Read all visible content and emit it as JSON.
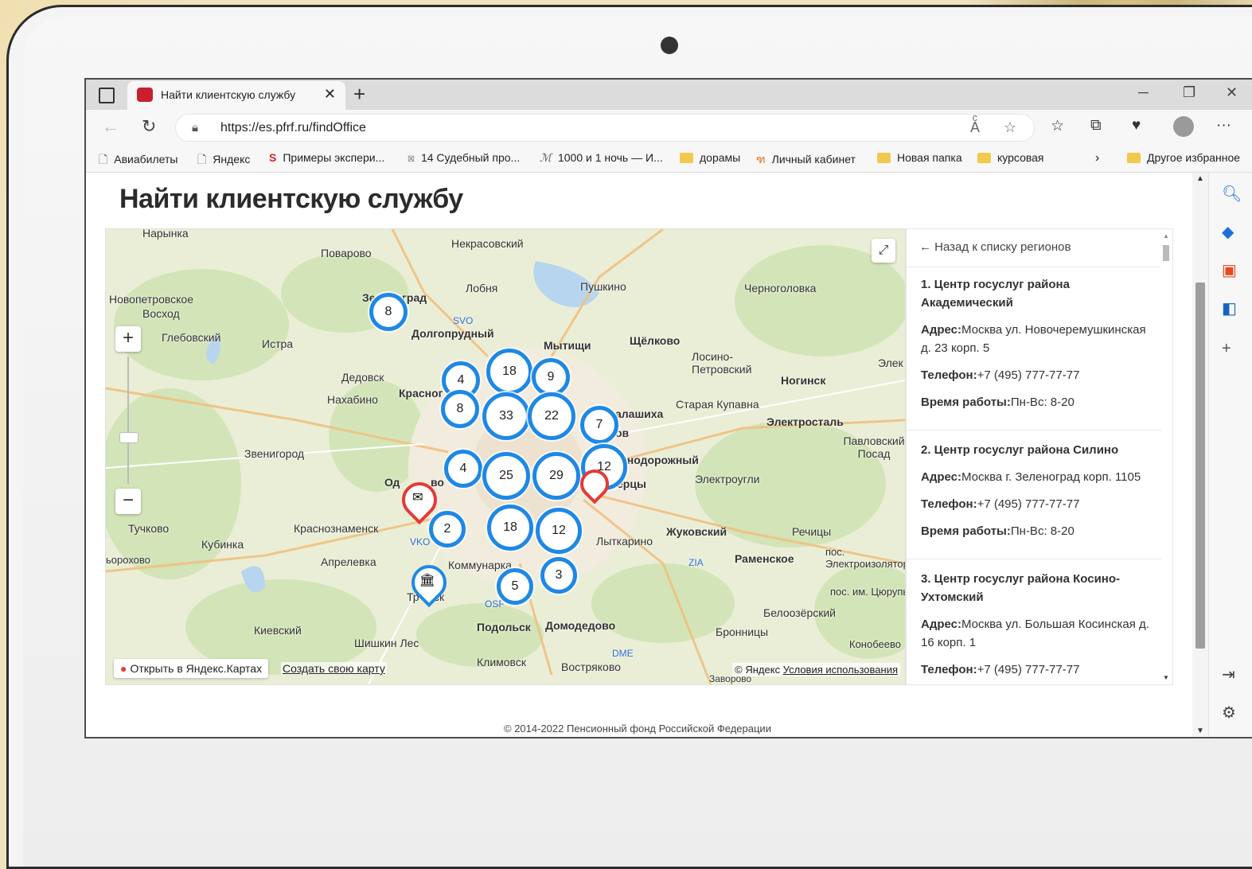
{
  "browser": {
    "tab_title": "Найти клиентскую службу",
    "url": "https://es.pfrf.ru/findOffice",
    "bookmarks": [
      "Авиабилеты",
      "Яндекс",
      "Примеры экспери...",
      "14 Судебный про...",
      "1000 и 1 ночь — И...",
      "дорамы",
      "Личный кабинет",
      "Новая папка",
      "курсовая"
    ],
    "other_favorites": "Другое избранное"
  },
  "page": {
    "title": "Найти клиентскую службу",
    "footer": "© 2014-2022 Пенсионный фонд Российской Федерации"
  },
  "map": {
    "clusters": [
      "8",
      "4",
      "18",
      "9",
      "8",
      "33",
      "22",
      "7",
      "4",
      "25",
      "29",
      "12",
      "2",
      "18",
      "12",
      "3",
      "5"
    ],
    "places": [
      "Нарынка",
      "Некрасовский",
      "Поварово",
      "Новопетровское",
      "Восход",
      "Лобня",
      "Пушкино",
      "Черноголовка",
      "Зеленоград",
      "SVO",
      "Долгопрудный",
      "Мытищи",
      "Щёлково",
      "Глебовский",
      "Истра",
      "Лосино-Петровский",
      "Элек",
      "Дедовск",
      "Ногинск",
      "Нахабино",
      "Красног",
      "Старая Купавна",
      "алашиха",
      "Электросталь",
      "Павловский Посад",
      "Звенигород",
      "ов",
      "езнодорожный",
      "Электроугли",
      "Од",
      "во",
      "ерцы",
      "Тучково",
      "Краснознаменск",
      "Кубинка",
      "VKO",
      "Жуковский",
      "Речицы",
      "Лыткарино",
      "Апрелевка",
      "Коммунарка",
      "ZIA",
      "Раменское",
      "пос. Электроизолятор",
      "Тр",
      "ск",
      "OSF",
      "пос. им. Цюрупы",
      "Белоозёрский",
      "Киевский",
      "Подольск",
      "Домодедово",
      "Бронницы",
      "Шишкин Лес",
      "DME",
      "Конобеево",
      "Климовск",
      "Востряково",
      "Заворово",
      "ьорохово"
    ],
    "open_in_yandex": "Открыть в Яндекс.Картах",
    "create_map": "Создать свою карту",
    "copyright": "© Яндекс",
    "terms": "Условия использования"
  },
  "panel": {
    "back_link": "← Назад к списку регионов",
    "offices": [
      {
        "name": "1. Центр госуслуг района Академический",
        "address_label": "Адрес:",
        "address": "Москва ул. Новочеремушкинская д. 23 корп. 5",
        "phone_label": "Телефон:",
        "phone": "+7 (495) 777-77-77",
        "hours_label": "Время работы:",
        "hours": "Пн-Вс: 8-20"
      },
      {
        "name": "2. Центр госуслуг района Силино",
        "address_label": "Адрес:",
        "address": "Москва г. Зеленоград корп. 1105",
        "phone_label": "Телефон:",
        "phone": "+7 (495) 777-77-77",
        "hours_label": "Время работы:",
        "hours": "Пн-Вс: 8-20"
      },
      {
        "name": "3. Центр госуслуг района Косино-Ухтомский",
        "address_label": "Адрес:",
        "address": "Москва ул. Большая Косинская д. 16 корп. 1",
        "phone_label": "Телефон:",
        "phone": "+7 (495) 777-77-77"
      }
    ]
  }
}
